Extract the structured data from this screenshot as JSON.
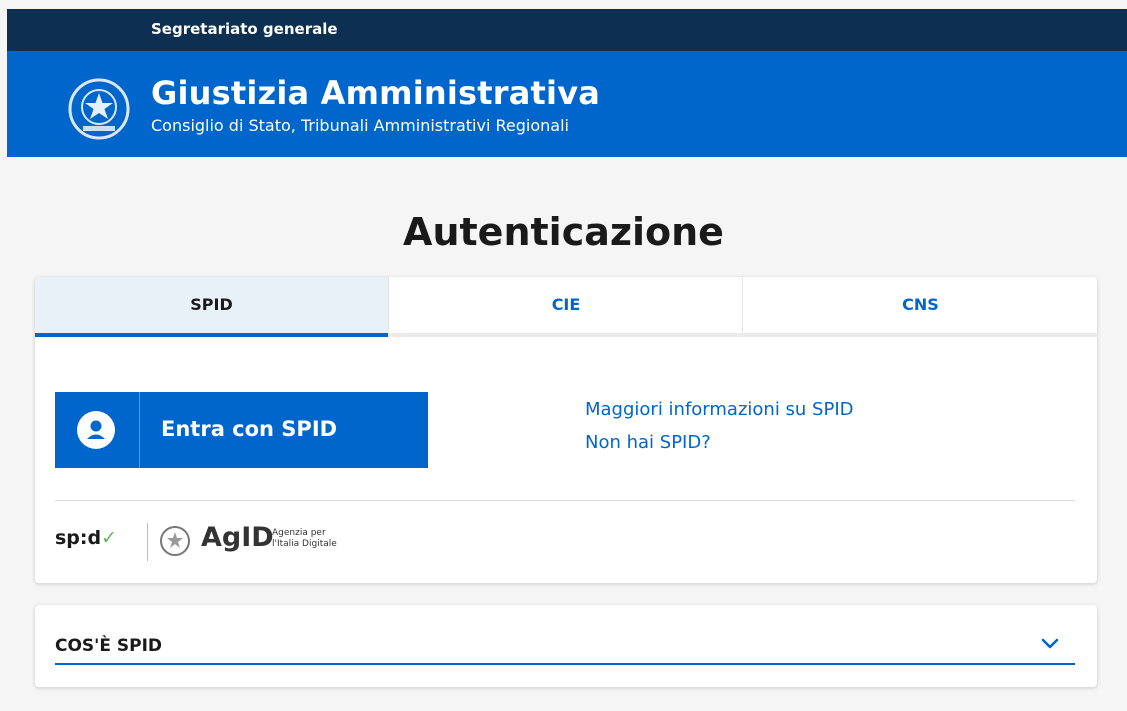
{
  "topbar": {
    "org_link": "Segretariato generale"
  },
  "header": {
    "title": "Giustizia Amministrativa",
    "subtitle": "Consiglio di Stato, Tribunali Amministrativi Regionali",
    "emblem_icon": "italian-republic-emblem-icon"
  },
  "page": {
    "title": "Autenticazione"
  },
  "tabs": [
    {
      "label": "SPID",
      "active": true
    },
    {
      "label": "CIE",
      "active": false
    },
    {
      "label": "CNS",
      "active": false
    }
  ],
  "spid_panel": {
    "login_button": "Entra con SPID",
    "button_icon": "user-icon",
    "links": [
      "Maggiori informazioni su SPID",
      "Non hai SPID?"
    ],
    "logos": {
      "spid_text": "sp:d",
      "spid_check": "✓",
      "agid_text": "AgID",
      "agid_sub_line1": "Agenzia per",
      "agid_sub_line2": "l'Italia Digitale"
    }
  },
  "accordion": {
    "title": "COS'È SPID",
    "icon": "chevron-down-icon"
  },
  "colors": {
    "primary": "#0066cc",
    "topbar": "#0c2f52",
    "tab_active_bg": "#e8f0f8"
  }
}
